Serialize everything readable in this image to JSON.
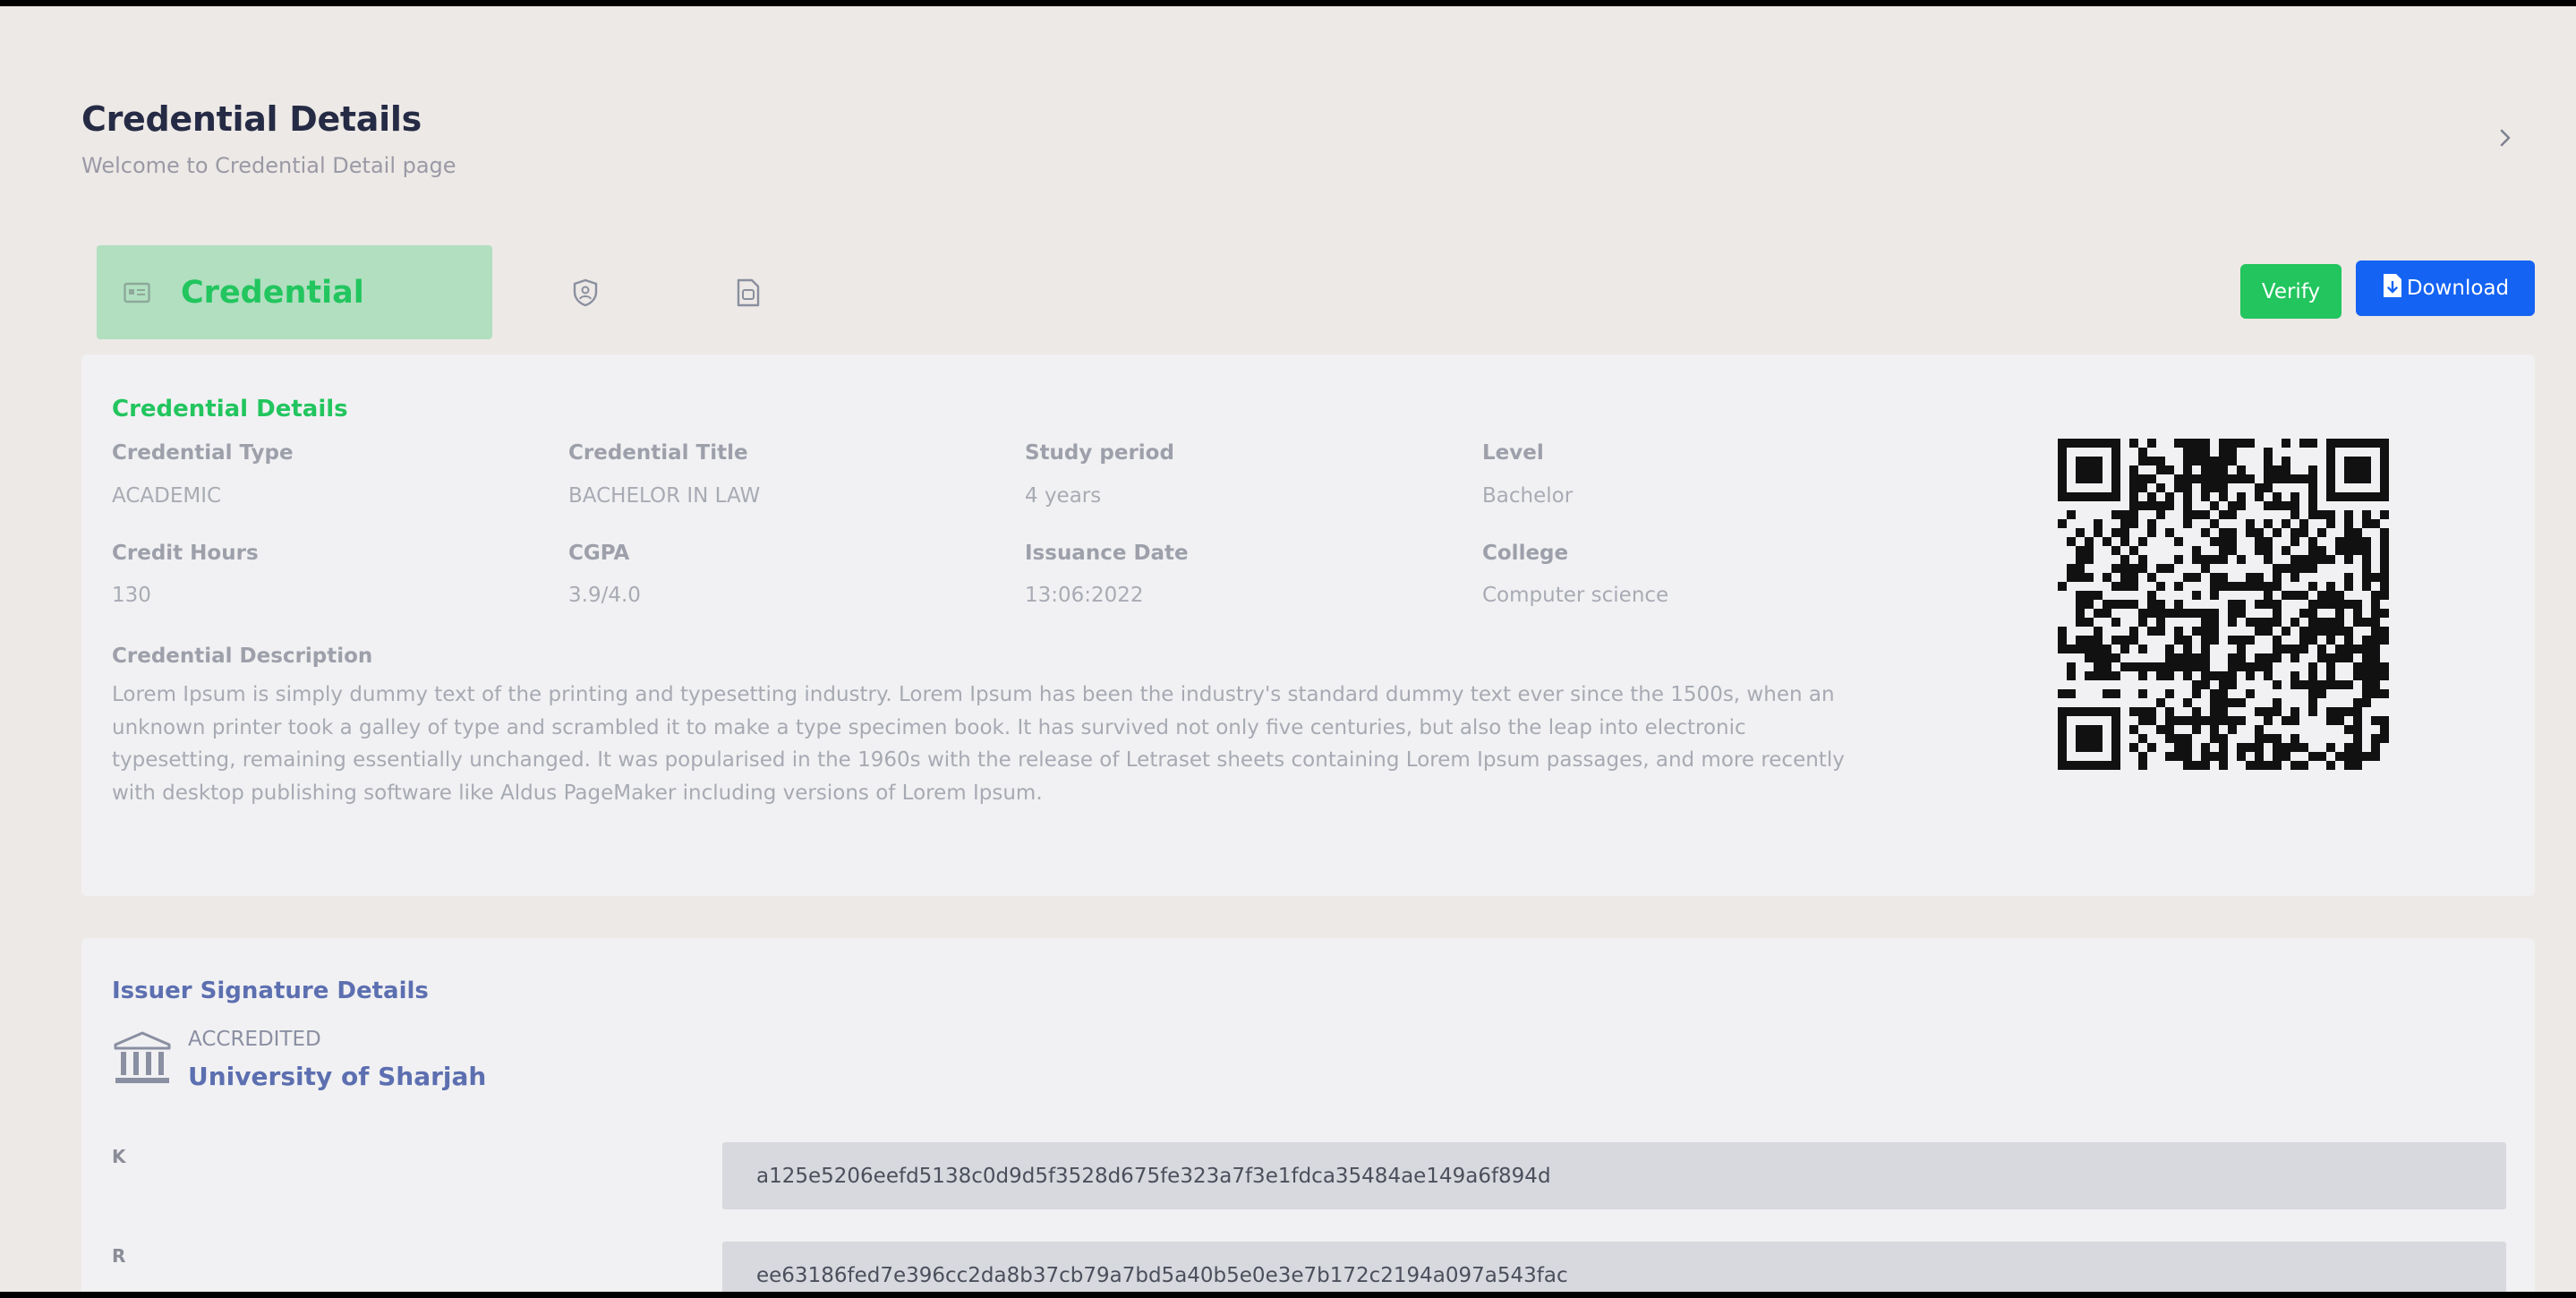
{
  "header": {
    "title": "Credential Details",
    "subtitle": "Welcome to Credential Detail page"
  },
  "tabs": [
    {
      "label": "Credential",
      "icon": "id-card-icon",
      "active": true
    },
    {
      "label": "",
      "icon": "badge-shield-icon",
      "active": false
    },
    {
      "label": "",
      "icon": "document-icon",
      "active": false
    }
  ],
  "actions": {
    "verify_label": "Verify",
    "download_label": "Download",
    "download_icon": "file-download-icon"
  },
  "credential": {
    "heading": "Credential Details",
    "fields": [
      {
        "label": "Credential Type",
        "value": "ACADEMIC"
      },
      {
        "label": "Credential Title",
        "value": "BACHELOR IN LAW"
      },
      {
        "label": "Study period",
        "value": "4 years"
      },
      {
        "label": "Level",
        "value": "Bachelor"
      },
      {
        "label": "Credit Hours",
        "value": "130"
      },
      {
        "label": "CGPA",
        "value": "3.9/4.0"
      },
      {
        "label": "Issuance Date",
        "value": "13:06:2022"
      },
      {
        "label": "College",
        "value": "Computer science"
      }
    ],
    "description_label": "Credential Description",
    "description_lines": [
      "Lorem Ipsum is simply dummy text of the printing and typesetting industry. Lorem Ipsum has been the industry's standard dummy text ever since the 1500s, when an",
      "unknown printer took a galley of type and scrambled it to make a type specimen book. It has survived not only five centuries, but also the leap into electronic",
      "typesetting, remaining essentially unchanged. It was popularised in the 1960s with the release of Letraset sheets containing Lorem Ipsum passages, and more recently",
      "with desktop publishing software like Aldus PageMaker including versions of Lorem Ipsum."
    ]
  },
  "issuer": {
    "heading": "Issuer Signature Details",
    "icon": "institution-icon",
    "status": "ACCREDITED",
    "name": "University of Sharjah",
    "signatures": [
      {
        "label": "K",
        "value": "a125e5206eefd5138c0d9d5f3528d675fe323a7f3e1fdca35484ae149a6f894d"
      },
      {
        "label": "R",
        "value": "ee63186fed7e396cc2da8b37cb79a7bd5a40b5e0e3e7b172c2194a097a543fac"
      }
    ]
  },
  "colors": {
    "accent_green": "#22c55e",
    "accent_blue": "#1463f3",
    "issuer_blue": "#5c6fb0"
  }
}
